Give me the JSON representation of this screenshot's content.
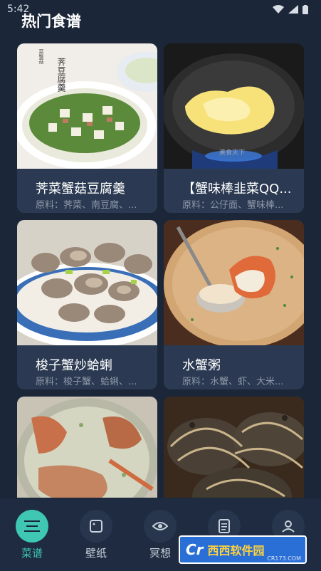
{
  "status_bar": {
    "time": "5:42"
  },
  "page": {
    "title": "热门食谱"
  },
  "recipes": [
    {
      "title": "荠菜蟹菇豆腐羹",
      "ingredients": "原料：荠菜、南豆腐、..."
    },
    {
      "title": "【蟹味棒韭菜QQ...",
      "ingredients": "原料：公仔面、蟹味棒..."
    },
    {
      "title": "梭子蟹炒蛤蜊",
      "ingredients": "原料：梭子蟹、蛤蜊、..."
    },
    {
      "title": "水蟹粥",
      "ingredients": "原料：水蟹、虾、大米..."
    },
    {
      "title": "",
      "ingredients": ""
    },
    {
      "title": "",
      "ingredients": ""
    }
  ],
  "photo_text": {
    "tofu_seal": "荠豆腐羹",
    "tofu_small": "菜蟹菇",
    "wok_mark": "美食天下"
  },
  "nav": {
    "items": [
      {
        "label": "菜谱",
        "icon": "menu-lines-icon",
        "active": true
      },
      {
        "label": "壁纸",
        "icon": "square-icon",
        "active": false
      },
      {
        "label": "冥想",
        "icon": "eye-icon",
        "active": false
      },
      {
        "label": "",
        "icon": "document-icon",
        "active": false
      },
      {
        "label": "",
        "icon": "user-icon",
        "active": false
      }
    ]
  },
  "watermark": {
    "logo": "Cr",
    "brand": "西西软件园",
    "domain": "CR173.COM"
  },
  "colors": {
    "background": "#1b2638",
    "card": "#2b3a52",
    "accent": "#3fc7b4",
    "nav": "#1e2b40"
  }
}
